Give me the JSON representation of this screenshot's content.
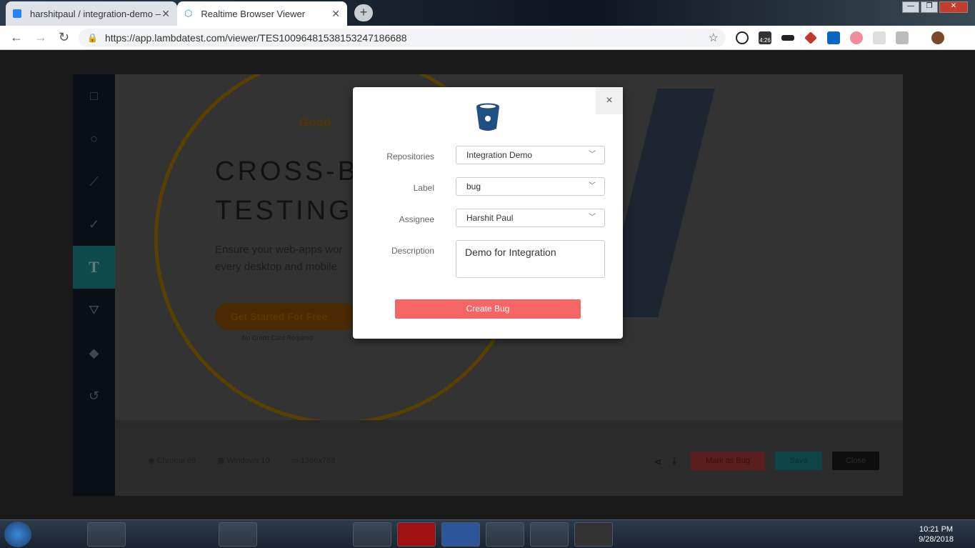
{
  "browser": {
    "tabs": [
      {
        "title": "harshitpaul / integration-demo –"
      },
      {
        "title": "Realtime Browser Viewer"
      }
    ],
    "url": "https://app.lambdatest.com/viewer/TES10096481538153247186688",
    "ext_badge": "4:26"
  },
  "background": {
    "good": "Good",
    "hero_line1": "CROSS-B",
    "hero_line2": "TESTING",
    "sub1": "Ensure your web-apps wor",
    "sub2": "every desktop and mobile",
    "cta": "Get Started For Free",
    "no_cc": "No Credit Card Required",
    "browser": "Chrome 69",
    "os": "Windows 10",
    "resolution": "1366x768",
    "mark_bug": "Mark as Bug",
    "save": "Save",
    "close": "Close"
  },
  "modal": {
    "close": "×",
    "fields": [
      {
        "label": "Repositories",
        "value": "Integration Demo"
      },
      {
        "label": "Label",
        "value": "bug"
      },
      {
        "label": "Assignee",
        "value": "Harshit Paul"
      }
    ],
    "description_label": "Description",
    "description_value": "Demo for Integration",
    "create_button": "Create Bug",
    "accent": "#f56565",
    "logo_color": "#205081"
  },
  "taskbar": {
    "time": "10:21 PM",
    "date": "9/28/2018"
  }
}
